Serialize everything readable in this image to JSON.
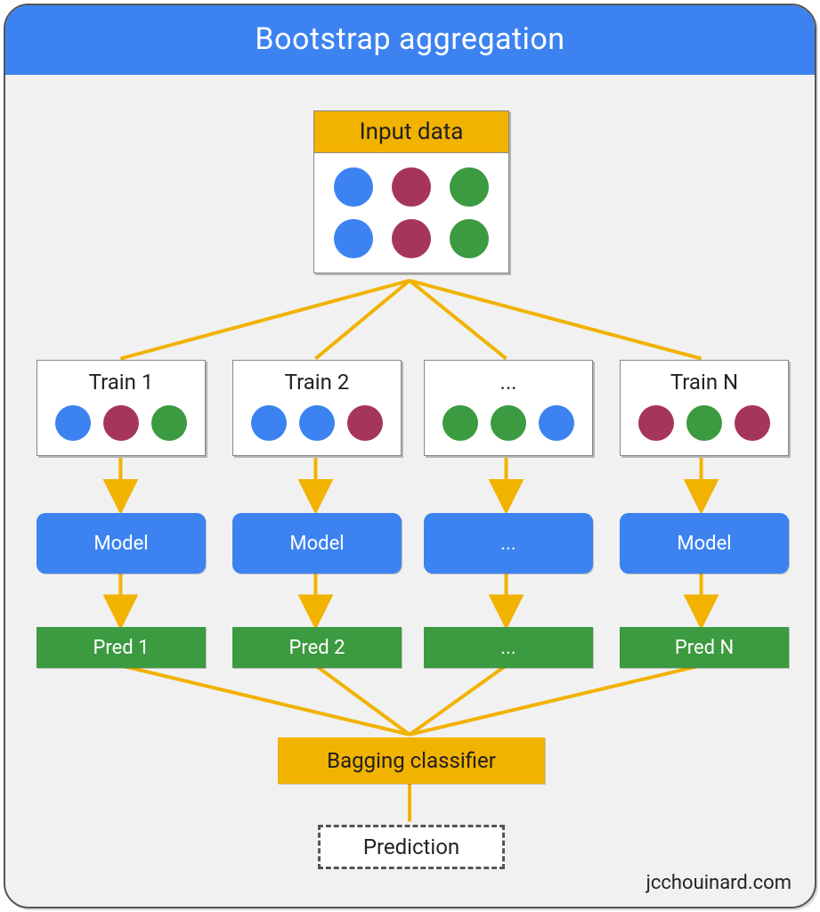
{
  "title": "Bootstrap aggregation",
  "input": {
    "label": "Input data",
    "dots": [
      "blue",
      "maroon",
      "green",
      "blue",
      "maroon",
      "green"
    ]
  },
  "columns": [
    {
      "train_label": "Train 1",
      "dots": [
        "blue",
        "maroon",
        "green"
      ],
      "model": "Model",
      "pred": "Pred 1"
    },
    {
      "train_label": "Train 2",
      "dots": [
        "blue",
        "blue",
        "maroon"
      ],
      "model": "Model",
      "pred": "Pred 2"
    },
    {
      "train_label": "...",
      "dots": [
        "green",
        "green",
        "blue"
      ],
      "model": "...",
      "pred": "..."
    },
    {
      "train_label": "Train N",
      "dots": [
        "maroon",
        "green",
        "maroon"
      ],
      "model": "Model",
      "pred": "Pred N"
    }
  ],
  "bagging_label": "Bagging classifier",
  "prediction_label": "Prediction",
  "credit": "jcchouinard.com"
}
